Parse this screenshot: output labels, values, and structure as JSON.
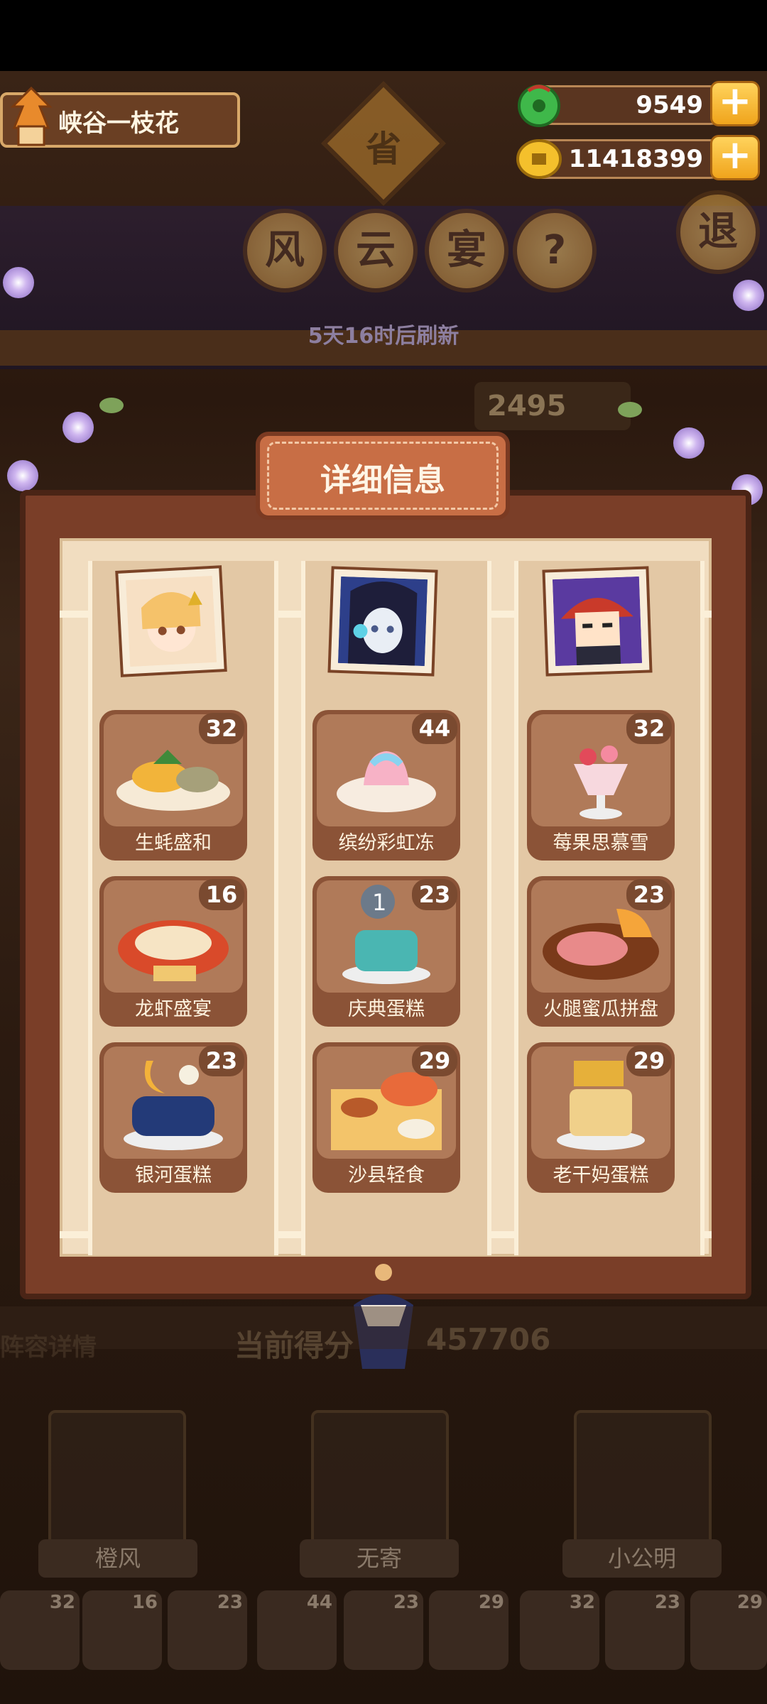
{
  "hud": {
    "player_name": "峡谷一枝花",
    "jade": "9549",
    "coins": "11418399",
    "plus": "+"
  },
  "header": {
    "province": "省",
    "title_chars": [
      "风",
      "云",
      "宴"
    ],
    "help": "?",
    "exit": "退",
    "refresh": "5天16时后刷新",
    "score_hint": "2495"
  },
  "panel": {
    "title": "详细信息",
    "columns": [
      {
        "chef": "橙风",
        "dishes": [
          {
            "name": "生蚝盛和",
            "count": "32"
          },
          {
            "name": "龙虾盛宴",
            "count": "16"
          },
          {
            "name": "银河蛋糕",
            "count": "23"
          }
        ]
      },
      {
        "chef": "无寄",
        "dishes": [
          {
            "name": "缤纷彩虹冻",
            "count": "44"
          },
          {
            "name": "庆典蛋糕",
            "count": "23"
          },
          {
            "name": "沙县轻食",
            "count": "29"
          }
        ]
      },
      {
        "chef": "小公明",
        "dishes": [
          {
            "name": "莓果思慕雪",
            "count": "32"
          },
          {
            "name": "火腿蜜瓜拼盘",
            "count": "23"
          },
          {
            "name": "老干妈蛋糕",
            "count": "29"
          }
        ]
      }
    ]
  },
  "bottom": {
    "lineup_label": "阵容详情",
    "score_text": "当前得分",
    "score_value": "457706",
    "chefs": [
      "橙风",
      "无寄",
      "小公明"
    ],
    "mini_counts": [
      "32",
      "16",
      "23",
      "44",
      "23",
      "29",
      "32",
      "23",
      "29"
    ]
  },
  "colors": {
    "frame": "#7a3e28",
    "paper": "#f1ddc0",
    "card": "#8b5337",
    "title": "#c86e45",
    "gold": "#f0a41c"
  }
}
